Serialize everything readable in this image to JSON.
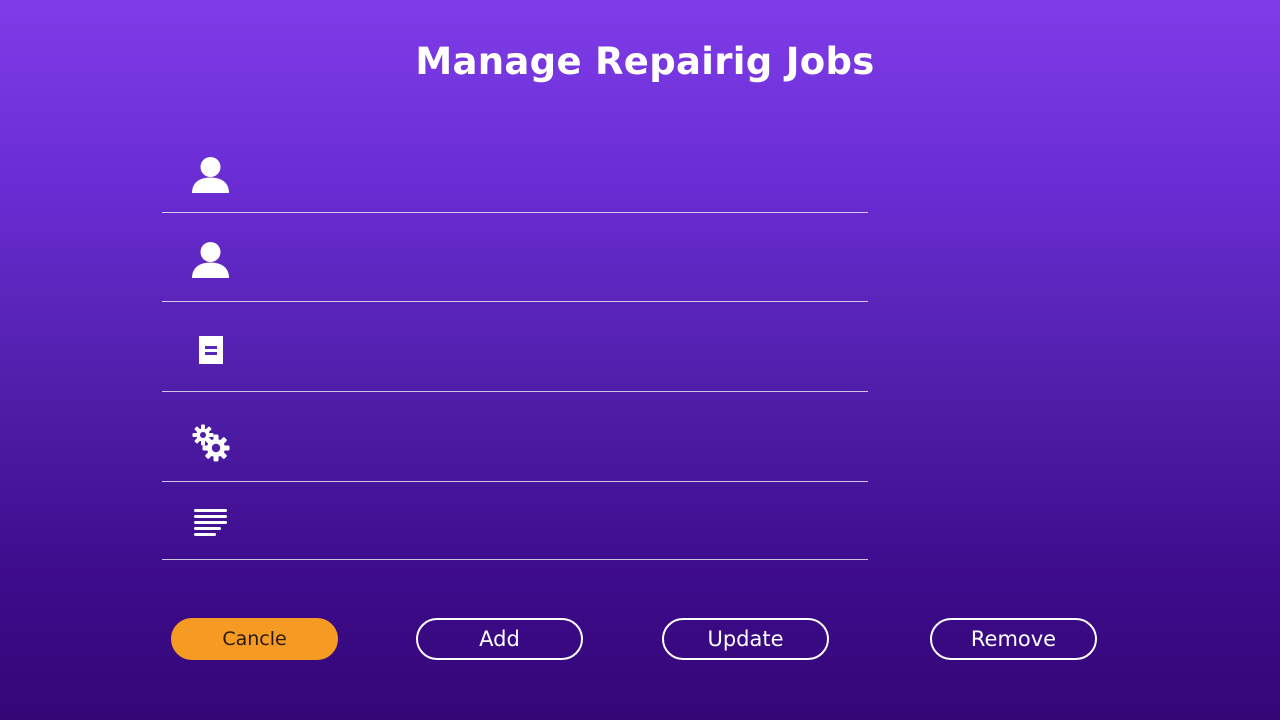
{
  "page": {
    "title": "Manage Repairig Jobs"
  },
  "fields": [
    {
      "icon": "user-icon",
      "value": "",
      "placeholder": ""
    },
    {
      "icon": "user-icon",
      "value": "",
      "placeholder": ""
    },
    {
      "icon": "document-icon",
      "value": "",
      "placeholder": ""
    },
    {
      "icon": "gears-icon",
      "value": "",
      "placeholder": ""
    },
    {
      "icon": "text-lines-icon",
      "value": "",
      "placeholder": ""
    }
  ],
  "buttons": {
    "cancel_label": "Cancle",
    "add_label": "Add",
    "update_label": "Update",
    "remove_label": "Remove"
  },
  "colors": {
    "background_top": "#7f3ce8",
    "background_bottom": "#340676",
    "accent_button": "#f59a23",
    "foreground": "#ffffff"
  }
}
